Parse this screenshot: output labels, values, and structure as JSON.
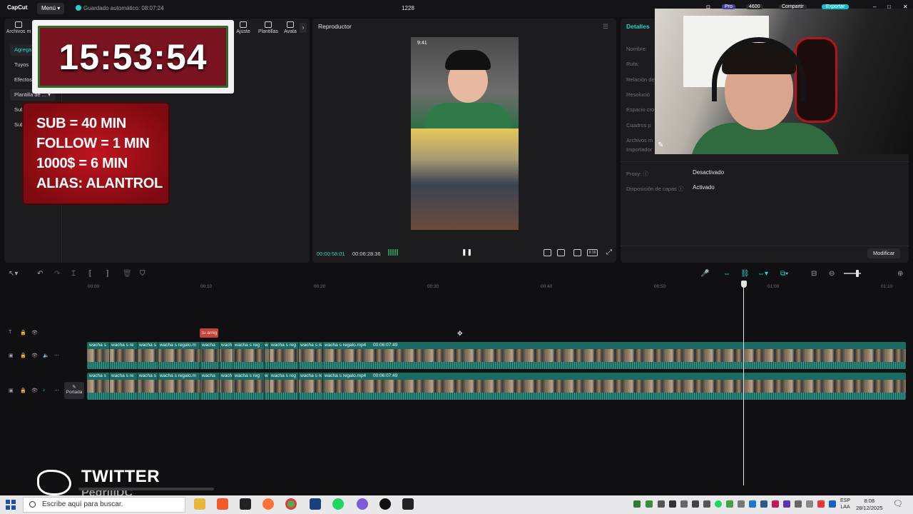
{
  "titlebar": {
    "logo": "CapCut",
    "menu_label": "Menú",
    "autosave_text": "Guardado automático: 08:07:24",
    "project_title": "1228"
  },
  "media_panel": {
    "tabs": [
      {
        "label": "Archivos m"
      },
      {
        "label": "Ajuste"
      },
      {
        "label": "Plantillas"
      },
      {
        "label": "Avata"
      }
    ],
    "side_items": [
      {
        "label": "Agrega",
        "active": true
      },
      {
        "label": "Tuyos"
      },
      {
        "label": "Efectos"
      },
      {
        "label": "Plantilla de ..."
      },
      {
        "label": "Sub"
      },
      {
        "label": "Sub"
      }
    ]
  },
  "overlays": {
    "countdown": "15:53:54",
    "rules": [
      "SUB = 40 MIN",
      "FOLLOW = 1 MIN",
      "1000$ = 6 MIN",
      "ALIAS: ALANTROL"
    ],
    "twitter_title": "TWITTER",
    "twitter_handle": "PedrijiDC"
  },
  "player": {
    "title": "Reproductor",
    "phone_time": "9:41",
    "current_time": "00:00:58:01",
    "total_time": "00:06:28:36",
    "ratio_label": "9:16"
  },
  "details": {
    "title": "Detalles",
    "fields": [
      {
        "label": "Nombre:"
      },
      {
        "label": "Ruta:"
      },
      {
        "label": "Relación de"
      },
      {
        "label": "Resolució"
      },
      {
        "label": "Espacio cro"
      },
      {
        "label": "Cuadros p"
      },
      {
        "label": "Archivos m"
      },
      {
        "label": "Importador"
      }
    ],
    "proxy_label": "Proxy:",
    "proxy_value": "Desactivado",
    "layers_label": "Disposición de capas",
    "layers_value": "Activado",
    "modify_button": "Modificar"
  },
  "webcam_chrome": {
    "pro_badge": "Pro",
    "credits": "4600",
    "share": "Compartir",
    "export": "Exportar"
  },
  "timeline": {
    "ruler": [
      "00:00",
      "00:10",
      "00:20",
      "00:30",
      "00:40",
      "00:50",
      "01:00",
      "01:10"
    ],
    "playhead_time_fraction": 0.89,
    "text_clip": "tu amig",
    "cover_label": "Portada",
    "track1_labels": [
      "wacha s",
      "wacha s re",
      "wacha s",
      "wacha s regalo.m",
      "wacha",
      "wach",
      "wacha s reg",
      "w",
      "wacha s reg",
      "wacha s re",
      "wacha s regalo.mp4",
      "00:06:07:49"
    ],
    "track2_labels": [
      "wacha s",
      "wacha s re",
      "wacha s",
      "wacha s regalo.m",
      "wacha",
      "wach",
      "wacha s reg",
      "w",
      "wacha s reg",
      "wacha s re",
      "wacha s regalo.mp4",
      "00:06:07:49"
    ]
  },
  "taskbar": {
    "search_placeholder": "Escribe aquí para buscar.",
    "lang_line1": "ESP",
    "lang_line2": "LAA",
    "time": "8:08",
    "date": "28/12/2025"
  },
  "colors": {
    "accent": "#2dd4bf",
    "track": "#1c6b62",
    "text_clip": "#c2453b",
    "overlay_red": "#b3141d"
  }
}
